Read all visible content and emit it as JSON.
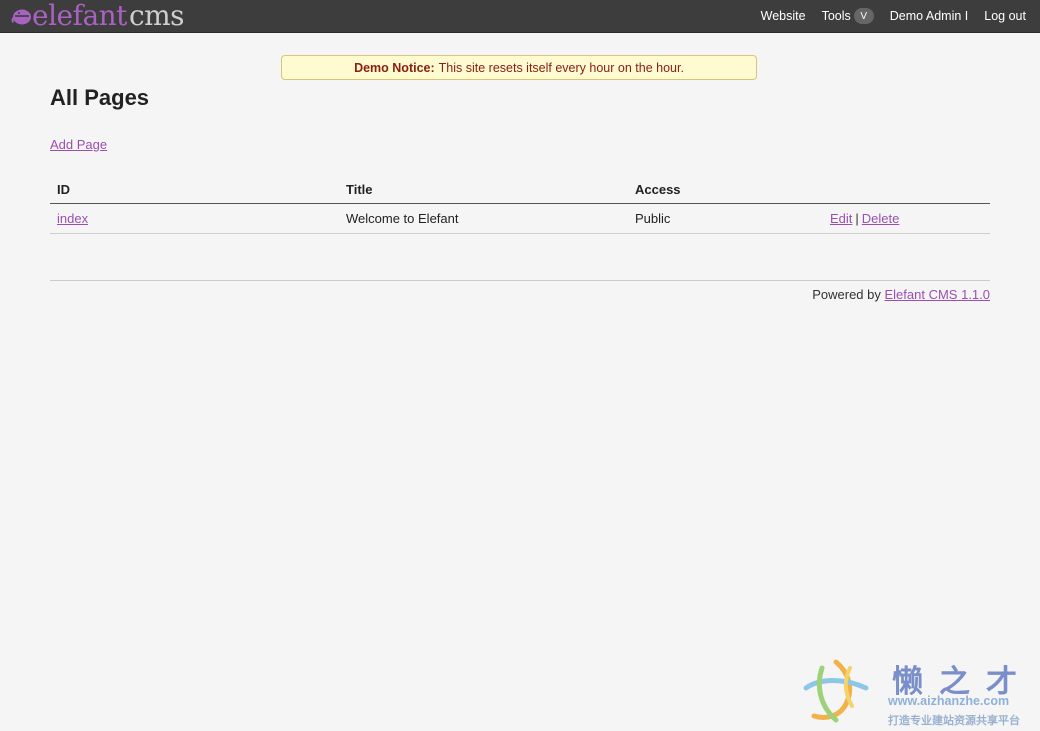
{
  "header": {
    "logo_word": "elefant",
    "logo_suffix": "cms",
    "nav": {
      "website": "Website",
      "tools": "Tools",
      "tools_toggle": "V",
      "user": "Demo Admin I",
      "logout": "Log out"
    }
  },
  "notice": {
    "label": "Demo Notice:",
    "message": "This site resets itself every hour on the hour."
  },
  "main": {
    "title": "All Pages",
    "add_page": "Add Page",
    "table": {
      "columns": [
        "ID",
        "Title",
        "Access",
        ""
      ],
      "rows": [
        {
          "id": "index",
          "title": "Welcome to Elefant",
          "access": "Public",
          "edit": "Edit",
          "separator": "|",
          "delete": "Delete"
        }
      ]
    }
  },
  "footer": {
    "powered_by": "Powered by",
    "link": "Elefant CMS 1.1.0"
  },
  "watermark": {
    "title": "懒之才",
    "url": "www.aizhanzhe.com",
    "slogan": "打造专业建站资源共享平台"
  },
  "colors": {
    "topbar": "#3d3d3d",
    "brand_purple": "#a862c0",
    "link": "#9b4fb0",
    "notice_bg": "#fffbd0",
    "notice_text": "#8a2014",
    "page_bg": "#f5f5f5"
  },
  "icons": {
    "logo": "elephant-e-icon",
    "tools_toggle": "chevron-down-icon",
    "watermark_logo": "swirl-star-icon"
  }
}
